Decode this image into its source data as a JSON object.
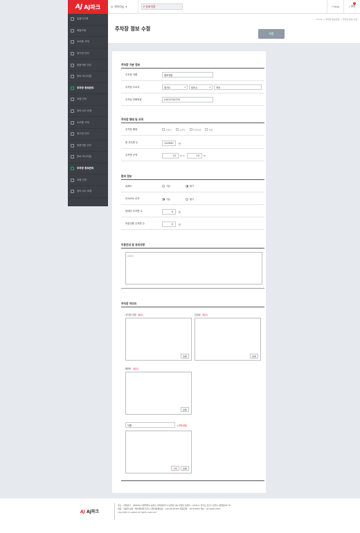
{
  "brand": {
    "logo_mark": "AJ",
    "logo_text": "AJ파크",
    "accent": "#e5262d"
  },
  "sidebar": {
    "items": [
      {
        "label": "입출차기록",
        "active": false
      },
      {
        "label": "매출조회",
        "active": false
      },
      {
        "label": "소모품 구매",
        "active": false
      },
      {
        "label": "정기권 관리",
        "active": false
      },
      {
        "label": "방문차량 관리",
        "active": false
      },
      {
        "label": "장비 모니터링",
        "active": false
      },
      {
        "label": "주차장 정보관리",
        "active": true
      },
      {
        "label": "요원 관리",
        "active": false
      },
      {
        "label": "장비 A/S 요청",
        "active": false
      },
      {
        "label": "소모품 구매",
        "active": false
      },
      {
        "label": "정기권 관리",
        "active": false
      },
      {
        "label": "방문차량 관리",
        "active": false
      },
      {
        "label": "장비 모니터링",
        "active": false
      },
      {
        "label": "주차장 정보관리",
        "active": true
      },
      {
        "label": "요원 관리",
        "active": false
      },
      {
        "label": "장비 A/S 요청",
        "active": false
      }
    ]
  },
  "topbar": {
    "user": "최아라님",
    "search_value": "P 방초차량",
    "btn_help": "Help",
    "btn_alarm": "알림",
    "alarm_count": "9"
  },
  "header": {
    "title": "주차장 정보 수정",
    "breadcrumb": "Home > 주차장 정보관리 > 주차장 정보 수정",
    "save_label": "저장"
  },
  "basic": {
    "title": "주차장 기본 정보",
    "name_label": "주차장 이름",
    "name_value": "청조차량",
    "addr_label": "주차장 주소지",
    "addr_1": "경기도",
    "addr_2": "부천시",
    "addr_3": "역곡",
    "phone_label": "주차장 전화번호",
    "phone_value": "01012341234"
  },
  "form": {
    "title": "주차장 형태 및 규격",
    "type_label": "주차장 형태",
    "types": [
      "기계식",
      "노면식",
      "주차타워",
      "자동"
    ],
    "count_label": "총 주차면 수",
    "count_value": "1243MV",
    "count_unit": "면",
    "size_label": "주차면 규격",
    "size_w": "10",
    "size_x": "m ×",
    "size_h": "10",
    "size_unit": "m"
  },
  "facility": {
    "title": "편의 정보",
    "valet_label": "AJ패스",
    "valet_opts": [
      "가능",
      "불가"
    ],
    "valet_on": 1,
    "suv_label": "SUV/RV 주차",
    "suv_opts": [
      "가능",
      "불가"
    ],
    "suv_on": 0,
    "disabled_label": "장애인 주차면 수",
    "disabled_value": "0",
    "disabled_unit": "면",
    "women_label": "여성전용 주차면 수",
    "women_value": "0",
    "women_unit": "면"
  },
  "notice": {
    "title": "이용안내 및 유의사항",
    "text": "ㅁㅁㅁ"
  },
  "images": {
    "title": "주차장 이미지",
    "front_label": "주차장 전경",
    "entry_label": "진입로",
    "map_label": "평면도",
    "required": "(필수)",
    "extra_name": "이름",
    "extra_optional": "(선택사항)",
    "upload": "등록",
    "delete": "삭제"
  },
  "footer": {
    "logo_mark": "AJ",
    "logo_text": "AJ파크",
    "line1": "주소 : 서울본사 : (05836) 서울특별시 송파구 정의로8길 9 AJ빌딩 1층    사업장 소재지 : (15411) 경기도 안산시 단원구 본원로08-78",
    "line2": "대표 : 이공덕    상호 : 에이제이파크(주)    사업자등록번호 : 120-86-26184    대표전화 : 1670-8302    팩스 : 02-6240-0057",
    "line3": "copyright (c) ajpark all rights reserved."
  }
}
